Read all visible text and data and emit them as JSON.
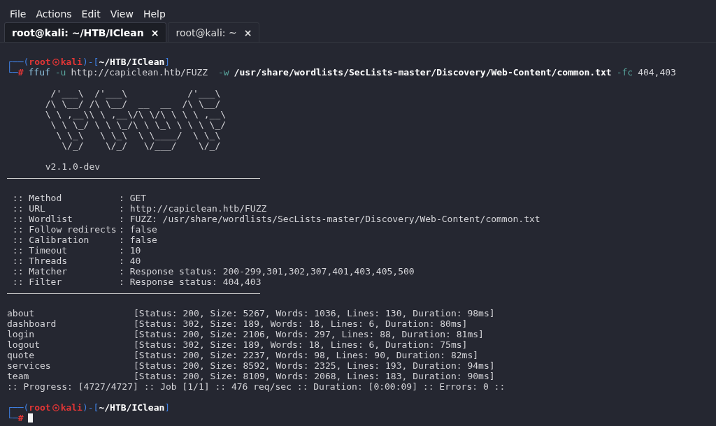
{
  "menu": [
    "File",
    "Actions",
    "Edit",
    "View",
    "Help"
  ],
  "tabs": [
    {
      "label": "root@kali: ~/HTB/IClean",
      "close": "×",
      "selected": true
    },
    {
      "label": "root@kali: ~",
      "close": "×",
      "selected": false
    }
  ],
  "terminal": {
    "lines": [
      {
        "kind": "prompt",
        "open": "┌──(",
        "user": "root",
        "host": "kali",
        "mid": ")-[",
        "dir": "~/HTB/IClean",
        "close": "]"
      },
      {
        "kind": "command",
        "corner": "└─",
        "symbol": "#",
        "segments": [
          {
            "kind": "program",
            "text": "ffuf"
          },
          {
            "kind": "flag",
            "text": "-u"
          },
          {
            "kind": "arg",
            "text": "http://capiclean.htb/FUZZ "
          },
          {
            "kind": "flag",
            "text": "-w"
          },
          {
            "kind": "path",
            "text": "/usr/share/wordlists/SecLists-master/Discovery/Web-Content/common.txt"
          },
          {
            "kind": "flag",
            "text": "-fc"
          },
          {
            "kind": "arg",
            "text": "404,403"
          }
        ]
      },
      {
        "kind": "blank"
      },
      {
        "kind": "art",
        "text": "        /'___\\  /'___\\           /'___\\"
      },
      {
        "kind": "art",
        "text": "       /\\ \\__/ /\\ \\__/  __  __  /\\ \\__/"
      },
      {
        "kind": "art",
        "text": "       \\ \\ ,__\\\\ \\ ,__\\/\\ \\/\\ \\ \\ \\ ,__\\"
      },
      {
        "kind": "art",
        "text": "        \\ \\ \\_/ \\ \\ \\_/\\ \\ \\_\\ \\ \\ \\ \\_/"
      },
      {
        "kind": "art",
        "text": "         \\ \\_\\   \\ \\_\\  \\ \\____/  \\ \\_\\"
      },
      {
        "kind": "art",
        "text": "          \\/_/    \\/_/   \\/___/    \\/_/"
      },
      {
        "kind": "blank"
      },
      {
        "kind": "text",
        "text": "       v2.1.0-dev"
      },
      {
        "kind": "rule"
      },
      {
        "kind": "blank"
      },
      {
        "kind": "option",
        "label": " :: Method",
        "value": ": GET"
      },
      {
        "kind": "option",
        "label": " :: URL",
        "value": ": http://capiclean.htb/FUZZ"
      },
      {
        "kind": "option",
        "label": " :: Wordlist",
        "value": ": FUZZ: /usr/share/wordlists/SecLists-master/Discovery/Web-Content/common.txt"
      },
      {
        "kind": "option",
        "label": " :: Follow redirects",
        "value": ": false"
      },
      {
        "kind": "option",
        "label": " :: Calibration",
        "value": ": false"
      },
      {
        "kind": "option",
        "label": " :: Timeout",
        "value": ": 10"
      },
      {
        "kind": "option",
        "label": " :: Threads",
        "value": ": 40"
      },
      {
        "kind": "option",
        "label": " :: Matcher",
        "value": ": Response status: 200-299,301,302,307,401,403,405,500"
      },
      {
        "kind": "option",
        "label": " :: Filter",
        "value": ": Response status: 404,403"
      },
      {
        "kind": "rule"
      },
      {
        "kind": "blank"
      },
      {
        "kind": "result",
        "name": "about",
        "details": "[Status: 200, Size: 5267, Words: 1036, Lines: 130, Duration: 98ms]"
      },
      {
        "kind": "result",
        "name": "dashboard",
        "details": "[Status: 302, Size: 189, Words: 18, Lines: 6, Duration: 80ms]"
      },
      {
        "kind": "result",
        "name": "login",
        "details": "[Status: 200, Size: 2106, Words: 297, Lines: 88, Duration: 81ms]"
      },
      {
        "kind": "result",
        "name": "logout",
        "details": "[Status: 302, Size: 189, Words: 18, Lines: 6, Duration: 75ms]"
      },
      {
        "kind": "result",
        "name": "quote",
        "details": "[Status: 200, Size: 2237, Words: 98, Lines: 90, Duration: 82ms]"
      },
      {
        "kind": "result",
        "name": "services",
        "details": "[Status: 200, Size: 8592, Words: 2325, Lines: 193, Duration: 94ms]"
      },
      {
        "kind": "result",
        "name": "team",
        "details": "[Status: 200, Size: 8109, Words: 2068, Lines: 183, Duration: 90ms]"
      },
      {
        "kind": "text",
        "text": ":: Progress: [4727/4727] :: Job [1/1] :: 476 req/sec :: Duration: [0:00:09] :: Errors: 0 ::"
      },
      {
        "kind": "blank"
      },
      {
        "kind": "prompt",
        "open": "┌──(",
        "user": "root",
        "host": "kali",
        "mid": ")-[",
        "dir": "~/HTB/IClean",
        "close": "]"
      },
      {
        "kind": "cursor",
        "corner": "└─",
        "symbol": "#"
      }
    ]
  }
}
